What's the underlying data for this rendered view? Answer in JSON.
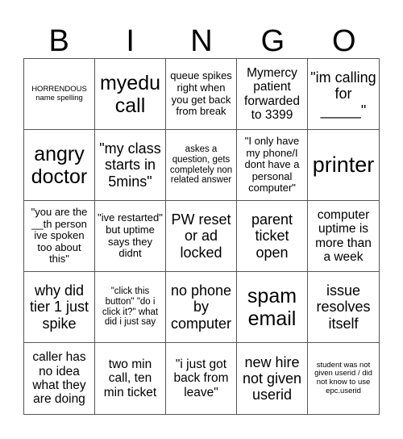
{
  "header": {
    "letters": [
      "B",
      "I",
      "N",
      "G",
      "O"
    ]
  },
  "cells": [
    "HORRENDOUS name spelling",
    "myedu call",
    "queue spikes right when you get back from break",
    "Mymercy patient forwarded to 3399",
    "\"im calling for _____\"",
    "angry doctor",
    "\"my class starts in 5mins\"",
    "askes a question, gets completely non related answer",
    "\"I only have my phone/I dont have a personal computer\"",
    "printer",
    "\"you are the __th person ive spoken too about this\"",
    "\"ive restarted\" but uptime says they didnt",
    "PW reset or ad locked",
    "parent ticket open",
    "computer uptime is more than a week",
    "why did tier 1 just spike",
    "\"click this button\" \"do i click it?\" what did i just say",
    "no phone by computer",
    "spam email",
    "issue resolves itself",
    "caller has no idea what they are doing",
    "two min call, ten min ticket",
    "\"i just got back from leave\"",
    "new hire not given userid",
    "student was not given userid / did not know to use epc.userid"
  ]
}
